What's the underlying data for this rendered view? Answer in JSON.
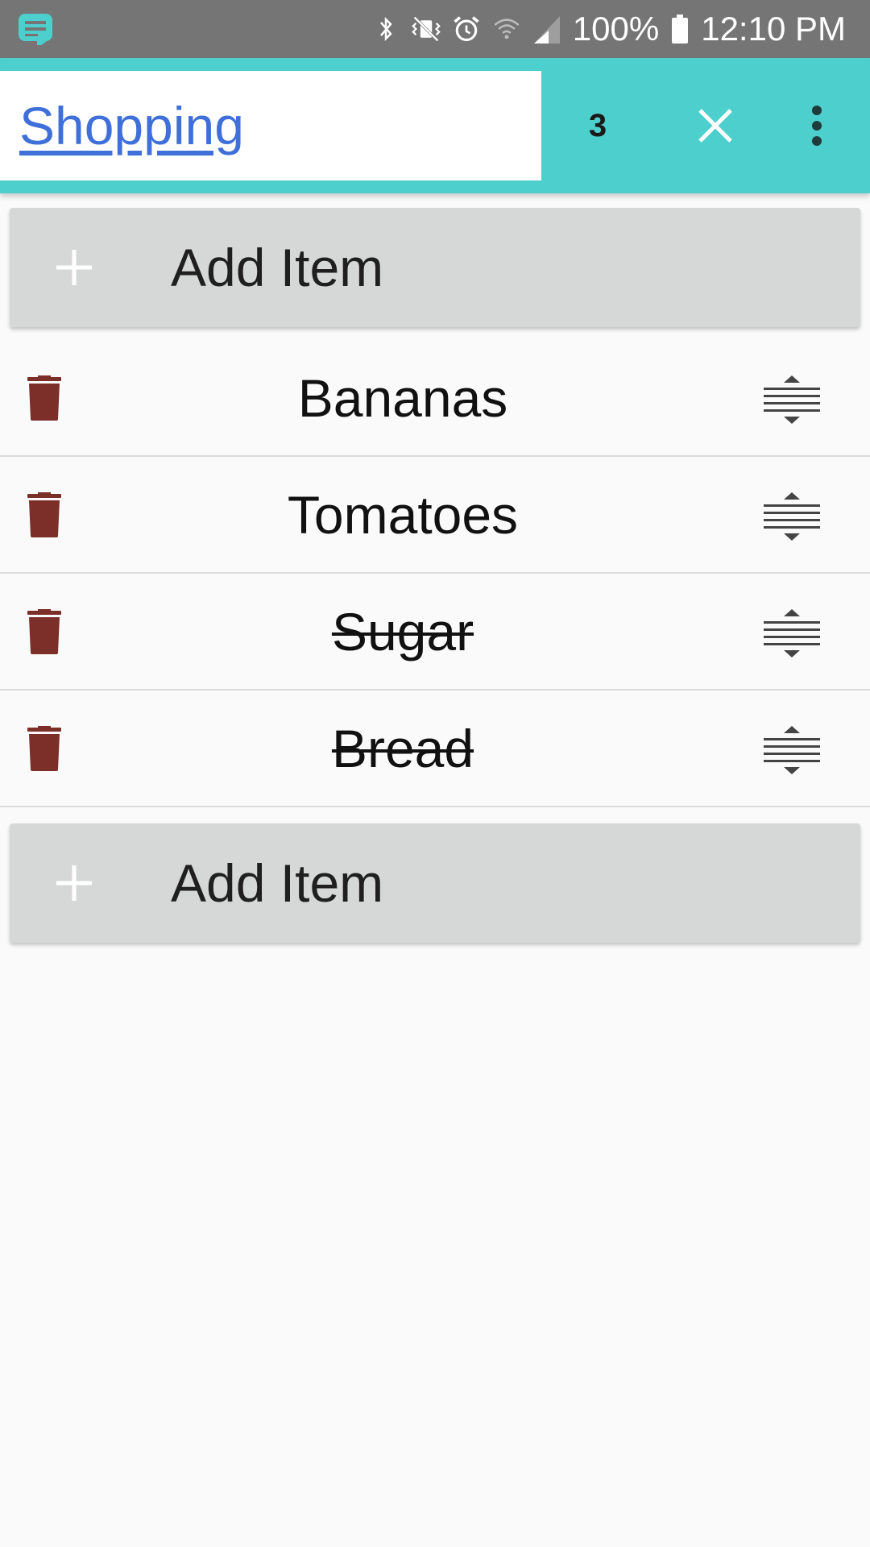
{
  "status_bar": {
    "battery": "100%",
    "time": "12:10 PM",
    "icons": [
      "notes-app-icon",
      "bluetooth-icon",
      "vibrate-icon",
      "alarm-icon",
      "wifi-icon",
      "signal-icon",
      "battery-icon"
    ]
  },
  "toolbar": {
    "list_title": "Shopping",
    "count": "3"
  },
  "add_item_label": "Add Item",
  "items": [
    {
      "name": "Bananas",
      "checked": false
    },
    {
      "name": "Tomatoes",
      "checked": false
    },
    {
      "name": "Sugar",
      "checked": true
    },
    {
      "name": "Bread",
      "checked": true
    }
  ],
  "colors": {
    "toolbar": "#4dd0cd",
    "status_bar": "#757575",
    "trash": "#7b2f28",
    "link": "#3f6fd8"
  }
}
